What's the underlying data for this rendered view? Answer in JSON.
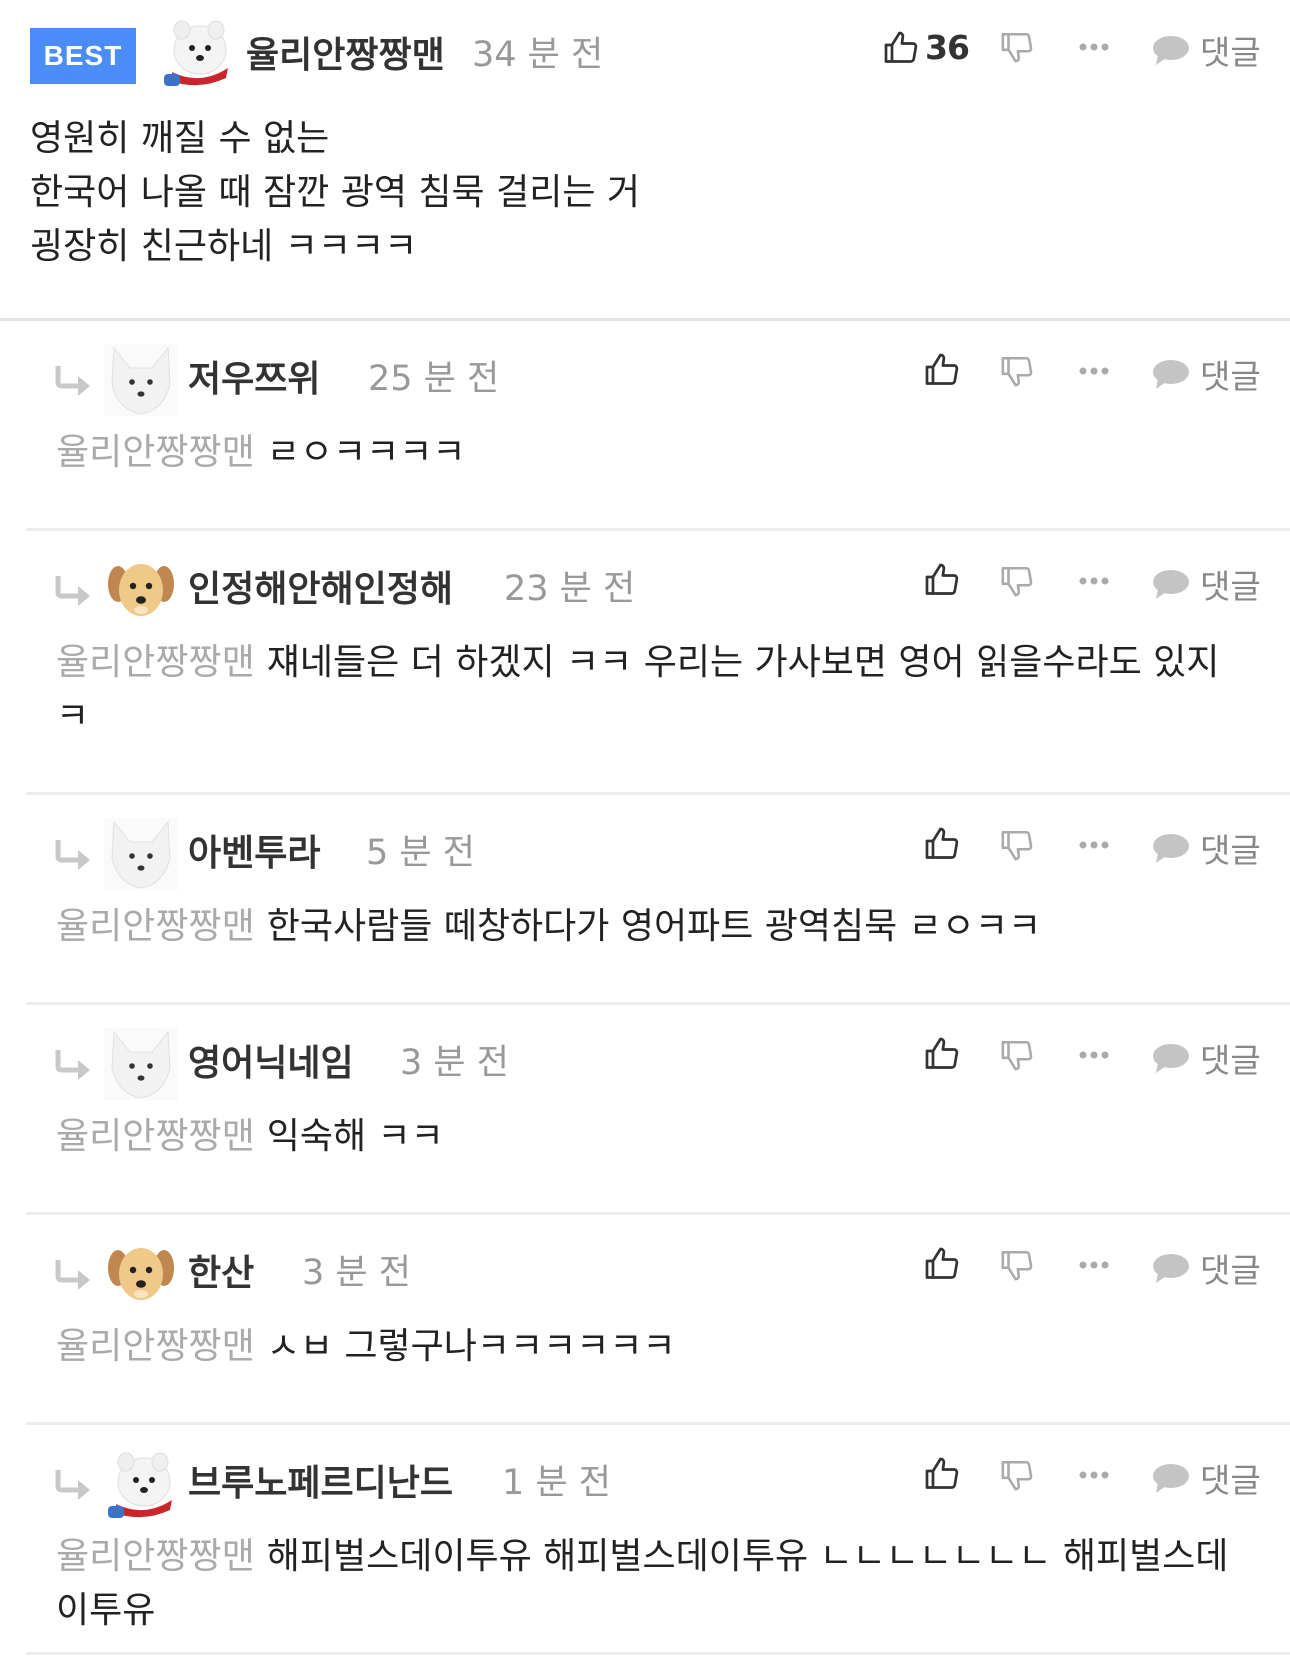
{
  "best_comment": {
    "badge": "BEST",
    "author": "율리안짱짱맨",
    "time": "34 분 전",
    "like_count": "36",
    "reply_label": "댓글",
    "avatar": "white-dog-red-scarf-icon",
    "lines": [
      "영원히 깨질 수 없는",
      "한국어 나올 때 잠깐 광역 침묵 걸리는 거",
      "굉장히 친근하네 ㅋㅋㅋㅋ"
    ]
  },
  "replies": [
    {
      "author": "저우쯔위",
      "time": "25 분 전",
      "mention": "율리안짱짱맨",
      "text": "ㄹㅇㅋㅋㅋㅋ",
      "reply_label": "댓글",
      "avatar": "white-fox-icon"
    },
    {
      "author": "인정해안해인정해",
      "time": "23 분 전",
      "mention": "율리안짱짱맨",
      "text": "쟤네들은 더 하겠지 ㅋㅋ 우리는 가사보면 영어 읽을수라도 있지 ㅋ",
      "reply_label": "댓글",
      "avatar": "puppy-icon"
    },
    {
      "author": "아벤투라",
      "time": "5 분 전",
      "mention": "율리안짱짱맨",
      "text": "한국사람들 떼창하다가 영어파트 광역침묵 ㄹㅇㅋㅋ",
      "reply_label": "댓글",
      "avatar": "white-fox-icon"
    },
    {
      "author": "영어닉네임",
      "time": "3 분 전",
      "mention": "율리안짱짱맨",
      "text": "익숙해 ㅋㅋ",
      "reply_label": "댓글",
      "avatar": "white-fox-icon"
    },
    {
      "author": "한산",
      "time": "3 분 전",
      "mention": "율리안짱짱맨",
      "text": "ㅅㅂ 그렇구나ㅋㅋㅋㅋㅋㅋ",
      "reply_label": "댓글",
      "avatar": "puppy-icon"
    },
    {
      "author": "브루노페르디난드",
      "time": "1 분 전",
      "mention": "율리안짱짱맨",
      "text": "해피벌스데이투유 해피벌스데이투유 ㄴㄴㄴㄴㄴㄴㄴ 해피벌스데이투유",
      "reply_label": "댓글",
      "avatar": "white-dog-red-scarf-icon"
    }
  ]
}
